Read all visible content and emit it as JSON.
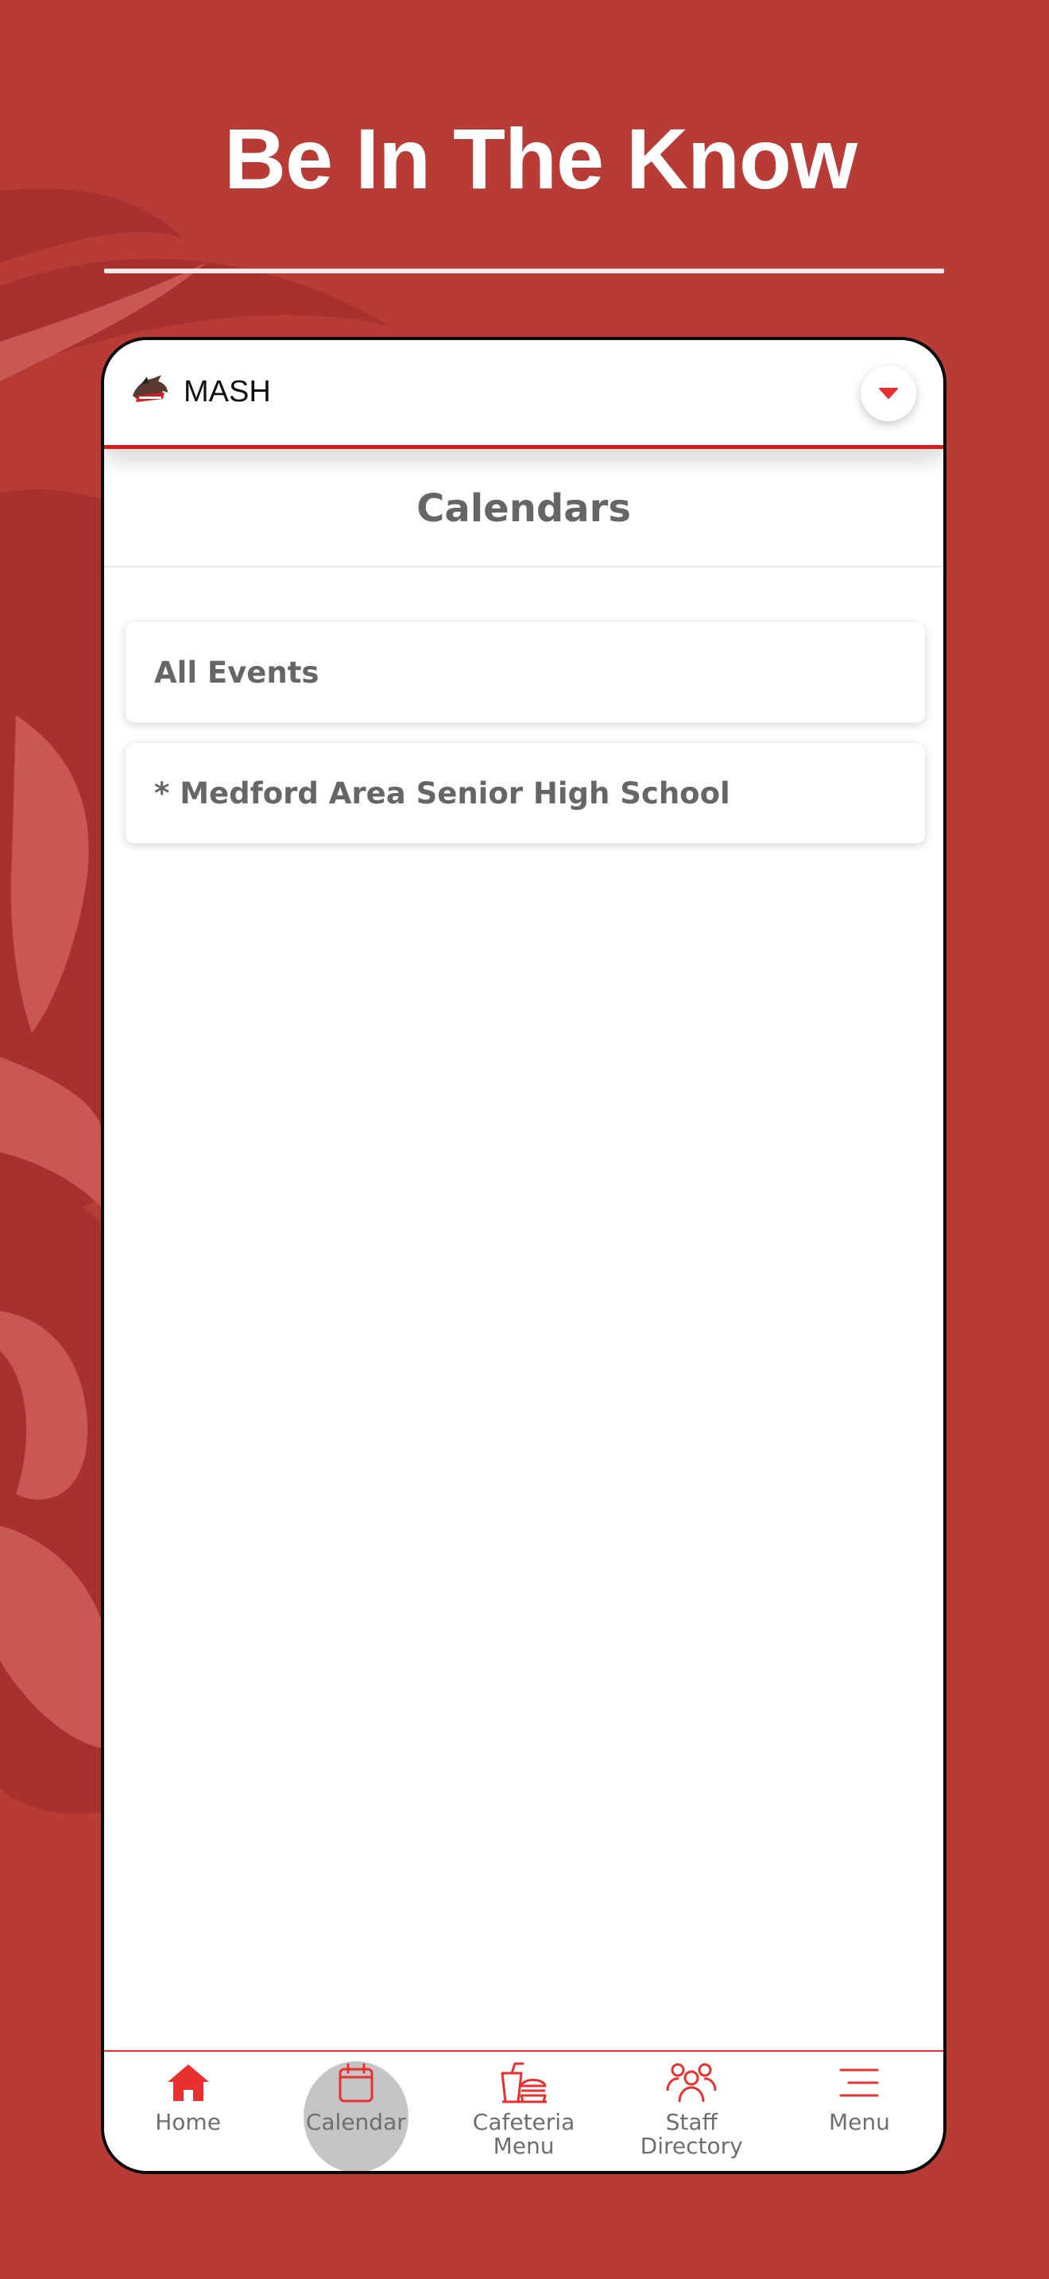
{
  "headline": "Be In The Know",
  "app": {
    "school_name": "MASH",
    "page_title": "Calendars",
    "calendars": [
      {
        "label": "All Events"
      },
      {
        "label": "* Medford Area Senior High School"
      }
    ],
    "tabs": [
      {
        "label": "Home",
        "icon": "home-icon",
        "active": false
      },
      {
        "label": "Calendar",
        "icon": "calendar-icon",
        "active": true
      },
      {
        "label": "Cafeteria\nMenu",
        "icon": "cafeteria-icon",
        "active": false
      },
      {
        "label": "Staff\nDirectory",
        "icon": "staff-directory-icon",
        "active": false
      },
      {
        "label": "Menu",
        "icon": "menu-icon",
        "active": false
      }
    ]
  },
  "colors": {
    "background": "#b83b36",
    "accent": "#e8302f",
    "text_gray": "#666666"
  }
}
